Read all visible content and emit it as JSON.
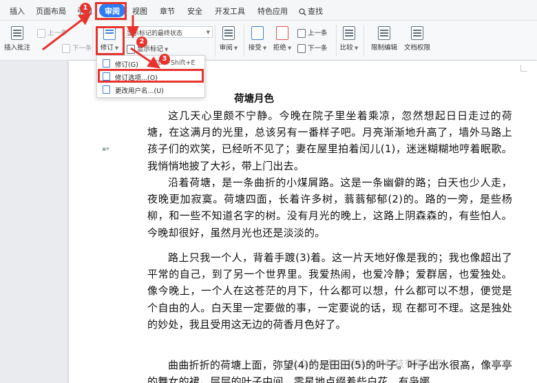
{
  "tabs": [
    {
      "label": "插入"
    },
    {
      "label": "页面布局"
    },
    {
      "label": "引用"
    },
    {
      "label": "审阅"
    },
    {
      "label": "视图"
    },
    {
      "label": "章节"
    },
    {
      "label": "安全"
    },
    {
      "label": "开发工具"
    },
    {
      "label": "特色应用"
    },
    {
      "label": "查找"
    }
  ],
  "ribbon": {
    "insert_comment": "插入批注",
    "prev": "上一条",
    "next": "下一条",
    "revise": "修订",
    "markup_state": "显示标记的最终状态",
    "show_markup": "显示标记",
    "review": "审阅",
    "accept": "接受",
    "reject": "拒绝",
    "prev_change": "上一条",
    "next_change": "下一条",
    "compare": "比较",
    "restrict_edit": "限制编辑",
    "doc_permission": "文档权限"
  },
  "menu": {
    "items": [
      {
        "label": "修订(G)",
        "shortcut": "Ctrl+Shift+E"
      },
      {
        "label": "修订选项...(O)"
      },
      {
        "label": "更改用户名...(U)"
      }
    ]
  },
  "badges": [
    "1",
    "2",
    "3"
  ],
  "document": {
    "title": "荷塘月色",
    "paragraphs": [
      "这几天心里颇不宁静。今晚在院子里坐着乘凉，忽然想起日日走过的荷塘，在这满月的光里，总该另有一番样子吧。月亮渐渐地升高了，墙外马路上孩子们的欢笑，已经听不见了；妻在屋里拍着闰儿(1)，迷迷糊糊地哼着眠歌。我悄悄地披了大衫，带上门出去。",
      "沿着荷塘，是一条曲折的小煤屑路。这是一条幽僻的路；白天也少人走，夜晚更加寂寞。荷塘四面，长着许多树，蓊蓊郁郁(2)的。路的一旁，是些杨柳，和一些不知道名字的树。没有月光的晚上，这路上阴森森的，有些怕人。今晚却很好，虽然月光也还是淡淡的。",
      "路上只我一个人，背着手踱(3)着。这一片天地好像是我的；我也像超出了平常的自己，到了另一个世界里。我爱热闹，也爱冷静；爱群居，也爱独处。像今晚上，一个人在这苍茫的月下，什么都可以想，什么都可以不想，便觉是个自由的人。白天里一定要做的事，一定要说的话，现 在都可不理。这是独处的妙处，我且受用这无边的荷香月色好了。",
      "曲曲折折的荷塘上面，弥望(4)的是田田(5)的叶子。叶子出水很高，像亭亭的舞女的裙。层层的叶子中间，零星地点缀着些白花，有袅娜"
    ],
    "watermark": "公众号 · 和田同标电子科技有限公司"
  },
  "colors": {
    "accent": "#2c7cf6",
    "annotation": "#e8322b"
  }
}
